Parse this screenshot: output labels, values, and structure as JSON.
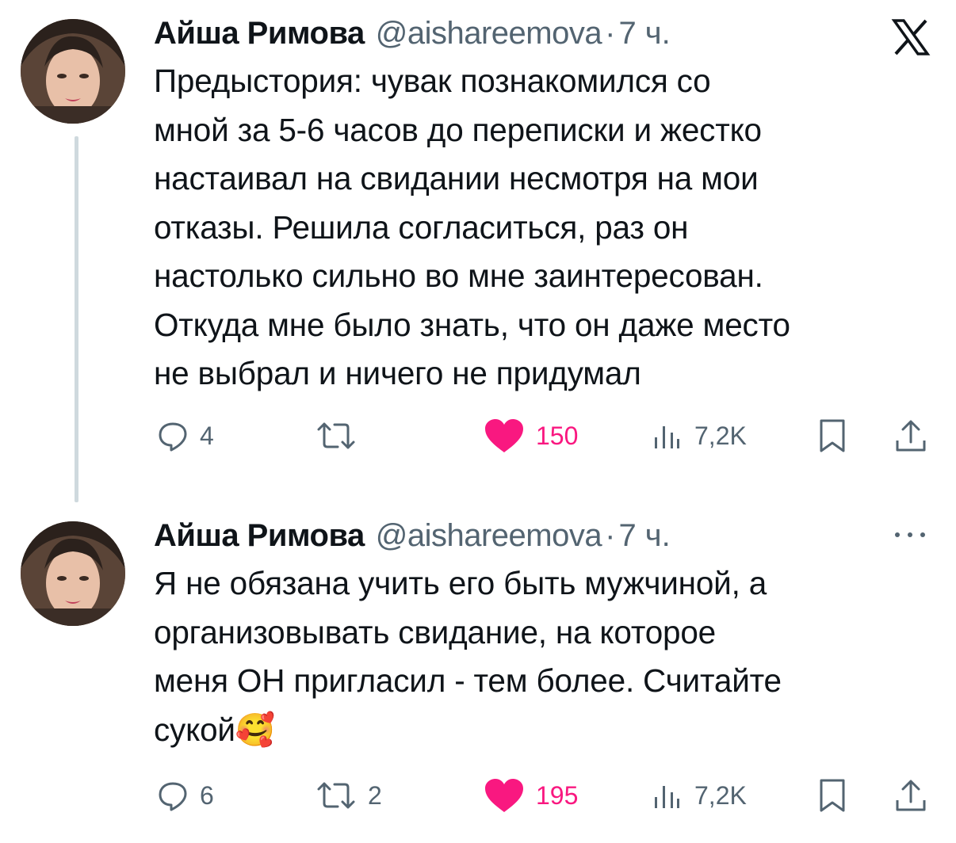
{
  "tweets": [
    {
      "author_name": "Айша Римова",
      "handle": "@aishareemova",
      "separator": "·",
      "time": "7 ч.",
      "text": "Предыстория: чувак познакомился со мной за 5-6 часов до переписки и жестко настаивал на свидании несмотря на мои отказы. Решила согласиться, раз он настолько сильно во мне заинтересован. Откуда мне было знать, что он даже место не выбрал и ничего не придумал",
      "text_lines": [
        "Предыстория: чувак познакомился со",
        "мной за 5-6 часов до переписки и жестко",
        "настаивал на свидании несмотря на мои",
        "отказы. Решила согласиться, раз он",
        "настолько сильно во мне заинтересован.",
        "Откуда мне было знать, что он даже место",
        "не выбрал и ничего не придумал"
      ],
      "header_icon": "x-logo-icon",
      "replies": "4",
      "reposts": "",
      "likes": "150",
      "views": "7,2K",
      "liked": true
    },
    {
      "author_name": "Айша Римова",
      "handle": "@aishareemova",
      "separator": "·",
      "time": "7 ч.",
      "text": "Я не обязана учить его быть мужчиной, а организовывать свидание, на которое меня ОН пригласил - тем более. Считайте сукой🥰",
      "text_lines": [
        "Я не обязана учить его быть мужчиной, а",
        "организовывать свидание, на которое",
        "меня ОН пригласил - тем более. Считайте",
        "сукой"
      ],
      "emoji": "🥰",
      "header_icon": "more-icon",
      "replies": "6",
      "reposts": "2",
      "likes": "195",
      "views": "7,2K",
      "liked": true
    }
  ],
  "colors": {
    "text": "#0f1419",
    "secondary": "#536471",
    "like": "#f91880",
    "thread_line": "#cfd9de"
  }
}
